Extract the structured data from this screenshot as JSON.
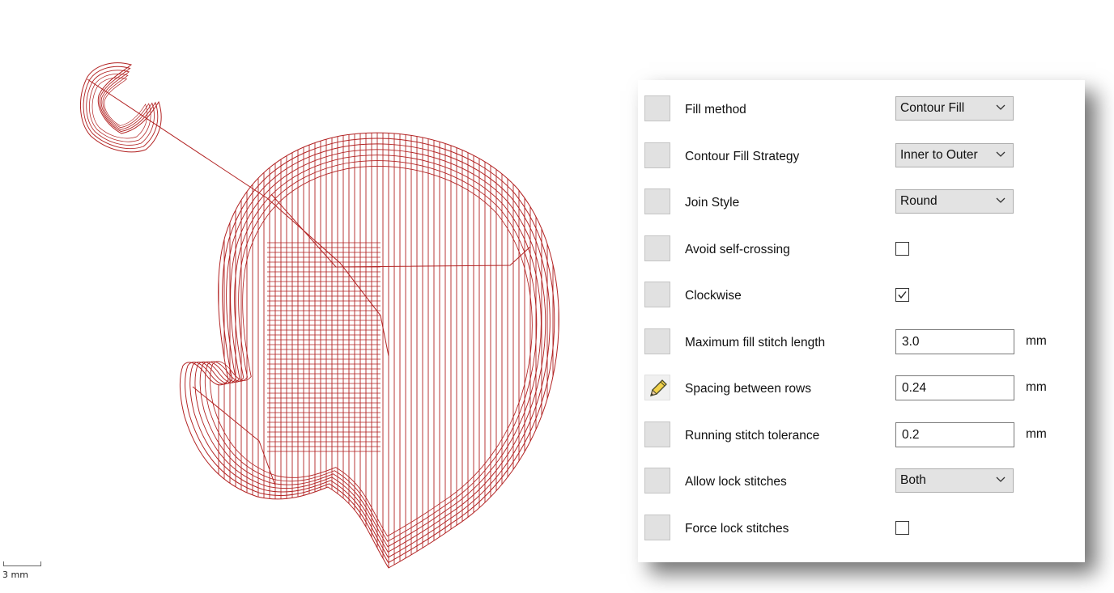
{
  "scale_label": "3 mm",
  "stitch_color": "#b22222",
  "panel": {
    "rows": [
      {
        "label": "Fill method",
        "control": "dropdown",
        "value": "Contour Fill"
      },
      {
        "label": "Contour Fill Strategy",
        "control": "dropdown",
        "value": "Inner to Outer"
      },
      {
        "label": "Join Style",
        "control": "dropdown",
        "value": "Round"
      },
      {
        "label": "Avoid self-crossing",
        "control": "checkbox",
        "checked": false
      },
      {
        "label": "Clockwise",
        "control": "checkbox",
        "checked": true
      },
      {
        "label": "Maximum fill stitch length",
        "control": "text",
        "value": "3.0",
        "unit": "mm"
      },
      {
        "label": "Spacing between rows",
        "control": "text",
        "value": "0.24",
        "unit": "mm",
        "icon": "pencil-icon"
      },
      {
        "label": "Running stitch tolerance",
        "control": "text",
        "value": "0.2",
        "unit": "mm"
      },
      {
        "label": "Allow lock stitches",
        "control": "dropdown",
        "value": "Both"
      },
      {
        "label": "Force lock stitches",
        "control": "checkbox",
        "checked": false
      }
    ]
  }
}
